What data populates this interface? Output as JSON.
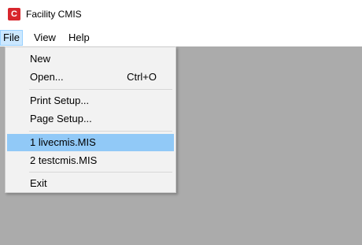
{
  "window": {
    "title": "Facility CMIS",
    "icon_letter": "C"
  },
  "menubar": {
    "file": "File",
    "view": "View",
    "help": "Help"
  },
  "file_menu": {
    "new": "New",
    "open": "Open...",
    "open_shortcut": "Ctrl+O",
    "print_setup": "Print Setup...",
    "page_setup": "Page Setup...",
    "recent_1": "1 livecmis.MIS",
    "recent_2": "2 testcmis.MIS",
    "exit": "Exit"
  },
  "colors": {
    "workspace": "#ababab",
    "highlight": "#91c9f7",
    "active_menu": "#cce8ff",
    "app_icon": "#d8262d"
  }
}
